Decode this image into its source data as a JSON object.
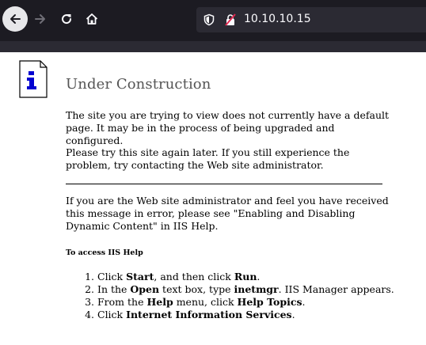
{
  "browser": {
    "url": "10.10.10.15"
  },
  "page": {
    "title": "Under Construction",
    "paragraph1": "The site you are trying to view does not currently have a default page. It may be in the process of being upgraded and configured.",
    "paragraph2": "Please try this site again later. If you still experience the problem, try contacting the Web site administrator.",
    "paragraph3": "If you are the Web site administrator and feel you have received this message in error, please see \"Enabling and Disabling Dynamic Content\" in IIS Help.",
    "help_heading": "To access IIS Help",
    "steps": [
      {
        "a": "Click ",
        "b1": "Start",
        "c": ", and then click ",
        "b2": "Run",
        "d": "."
      },
      {
        "a": "In the ",
        "b1": "Open",
        "c": " text box, type ",
        "b2": "inetmgr",
        "d": ". IIS Manager appears."
      },
      {
        "a": "From the ",
        "b1": "Help",
        "c": " menu, click ",
        "b2": "Help Topics",
        "d": "."
      },
      {
        "a": "Click ",
        "b1": "Internet Information Services",
        "c": "",
        "b2": "",
        "d": "."
      }
    ]
  },
  "icons": {
    "back": "back-arrow-icon",
    "forward": "forward-arrow-icon",
    "reload": "reload-icon",
    "home": "home-icon",
    "shield": "tracking-shield-icon",
    "lock": "insecure-lock-icon",
    "info": "info-document-icon"
  },
  "colors": {
    "toolbar": "#1c1b22",
    "urlbar": "#2b2a33",
    "insecure": "#e22850"
  }
}
